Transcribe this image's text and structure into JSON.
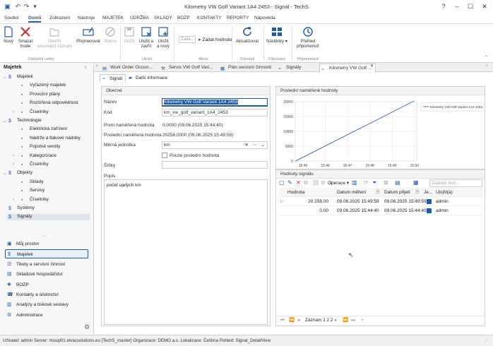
{
  "window": {
    "title": "Kilometry VW Golf Variant 1A4 2453 - Signál - TechS",
    "help": "?"
  },
  "menu": [
    "Soubor",
    "Domů",
    "Zobrazení",
    "Nástroje",
    "MAJETEK",
    "ÚDRŽBA",
    "SKLADY",
    "BOZP",
    "KONTAKTY",
    "REPORTY",
    "Nápověda"
  ],
  "ribbon": {
    "new": "Nový",
    "delete": [
      "Smazat",
      "trvale"
    ],
    "open_linked": [
      "Otevřít",
      "souvisejicí záznam"
    ],
    "rename": "Přejmenovat",
    "cancel": "Storno",
    "save": "Uložit",
    "save_close": [
      "Uložit a",
      "zavřít"
    ],
    "save_new": [
      "Uložit",
      "a nový"
    ],
    "enter_value_placeholder": "Zadá...",
    "enter_value": "Zadat hodnotu",
    "refresh": "Aktualizovat",
    "settings": [
      "Nástěnky"
    ],
    "overview": [
      "Přehled",
      "připomenutí"
    ],
    "groups": [
      "Základní volby",
      "Uložit",
      "Akce",
      "Zobrazit",
      "Filtrování",
      "Připomenutí"
    ]
  },
  "sidebar": {
    "title": "Majetek",
    "tree": [
      {
        "label": "Majetek",
        "level": 0,
        "expanded": true
      },
      {
        "label": "Vyřazený majetek",
        "level": 1
      },
      {
        "label": "Provozní plány",
        "level": 1
      },
      {
        "label": "Rozšířená odpovědnost",
        "level": 1
      },
      {
        "label": "Číselníky",
        "level": 1,
        "collapsed": true
      },
      {
        "label": "Technologie",
        "level": 0,
        "expanded": true
      },
      {
        "label": "Elektrická zařízení",
        "level": 1
      },
      {
        "label": "Nádrže a tlakové nádoby",
        "level": 1
      },
      {
        "label": "Pojistné ventily",
        "level": 1
      },
      {
        "label": "Kategorizace",
        "level": 1,
        "collapsed": true
      },
      {
        "label": "Číselníky",
        "level": 1,
        "collapsed": true
      },
      {
        "label": "Objekty",
        "level": 0,
        "expanded": true
      },
      {
        "label": "Sklady",
        "level": 1
      },
      {
        "label": "Servisy",
        "level": 1
      },
      {
        "label": "Číselníky",
        "level": 1,
        "collapsed": true
      },
      {
        "label": "Systémy",
        "level": 0
      },
      {
        "label": "Signály",
        "level": 0,
        "selected": true
      }
    ],
    "nav": [
      "Můj prostor",
      "Majetek",
      "Tikety a servisní činnost",
      "Skladové hospodářství",
      "BOZP",
      "Kontakty a účetnictví",
      "Analýzy a tiskové sestavy",
      "Administrace"
    ]
  },
  "doc_tabs": [
    "Work Order Occurr...",
    "Servis VW Golf Vari...",
    "Plán servisní činnosti",
    "Signály",
    "Kilometry VW Golf ..."
  ],
  "sub_tabs": [
    "Signál",
    "Další informace"
  ],
  "general": {
    "header": "Obecné",
    "name_label": "Název",
    "name": "Kilometry VW Golf Variant 1A4 2453",
    "code_label": "Kód",
    "code": "km_vw_golf_variant_1A4_2453",
    "first_label": "První naměřená hodnota",
    "first": "0,0000 (09.06.2025 15:44:40)",
    "last_label": "Poslední naměřená hodnota",
    "last": "20258,0000 (09.06.2025 15:49:59)",
    "unit_label": "Měrná jednotka",
    "unit": "km",
    "only_last": "Pouze poslední hodnota",
    "tags_label": "Štítky",
    "desc_label": "Popis",
    "desc": "počet ujetých km"
  },
  "chart_data": {
    "type": "line",
    "title": "Poslední naměřené hodnoty",
    "series": [
      {
        "name": "Kilometry VW Golf Variant 1A4 2453",
        "x": [
          "15:44:40",
          "15:49:59"
        ],
        "values": [
          0,
          20258
        ]
      }
    ],
    "x_ticks": [
      "15:45",
      "15:46",
      "15:47",
      "15:48",
      "15:49",
      "15:50"
    ],
    "y_ticks": [
      0,
      5000,
      10000,
      15000,
      20000
    ],
    "ylim": [
      0,
      20000
    ],
    "color": "#4472c4",
    "grid": true,
    "legend": "top-right"
  },
  "signal_values": {
    "header": "Hodnoty signálu",
    "toolbar_op": "Operace",
    "search_placeholder": "Zadejte text...",
    "columns": [
      "Hodnota",
      "Datum měření",
      "Datum přijetí",
      "Je...",
      "Uložil(a)"
    ],
    "rows": [
      {
        "value": "20 258,00",
        "measured": "09.06.2025 15:49:59",
        "received": "09.06.2025 15:49:59",
        "checked": true,
        "user": "admin"
      },
      {
        "value": "0,00",
        "measured": "09.06.2025 15:44:40",
        "received": "09.06.2025 15:44:40",
        "checked": true,
        "user": "admin"
      }
    ],
    "pager": "Záznam 1 z 2"
  },
  "status": "Uživatel: admin   Server: mssql01.elvacsolutions.eu [TechS_master]   Organizace: DEMO a.s.   Lokalizace: Čeština   Pohled: Signal_DetailView"
}
